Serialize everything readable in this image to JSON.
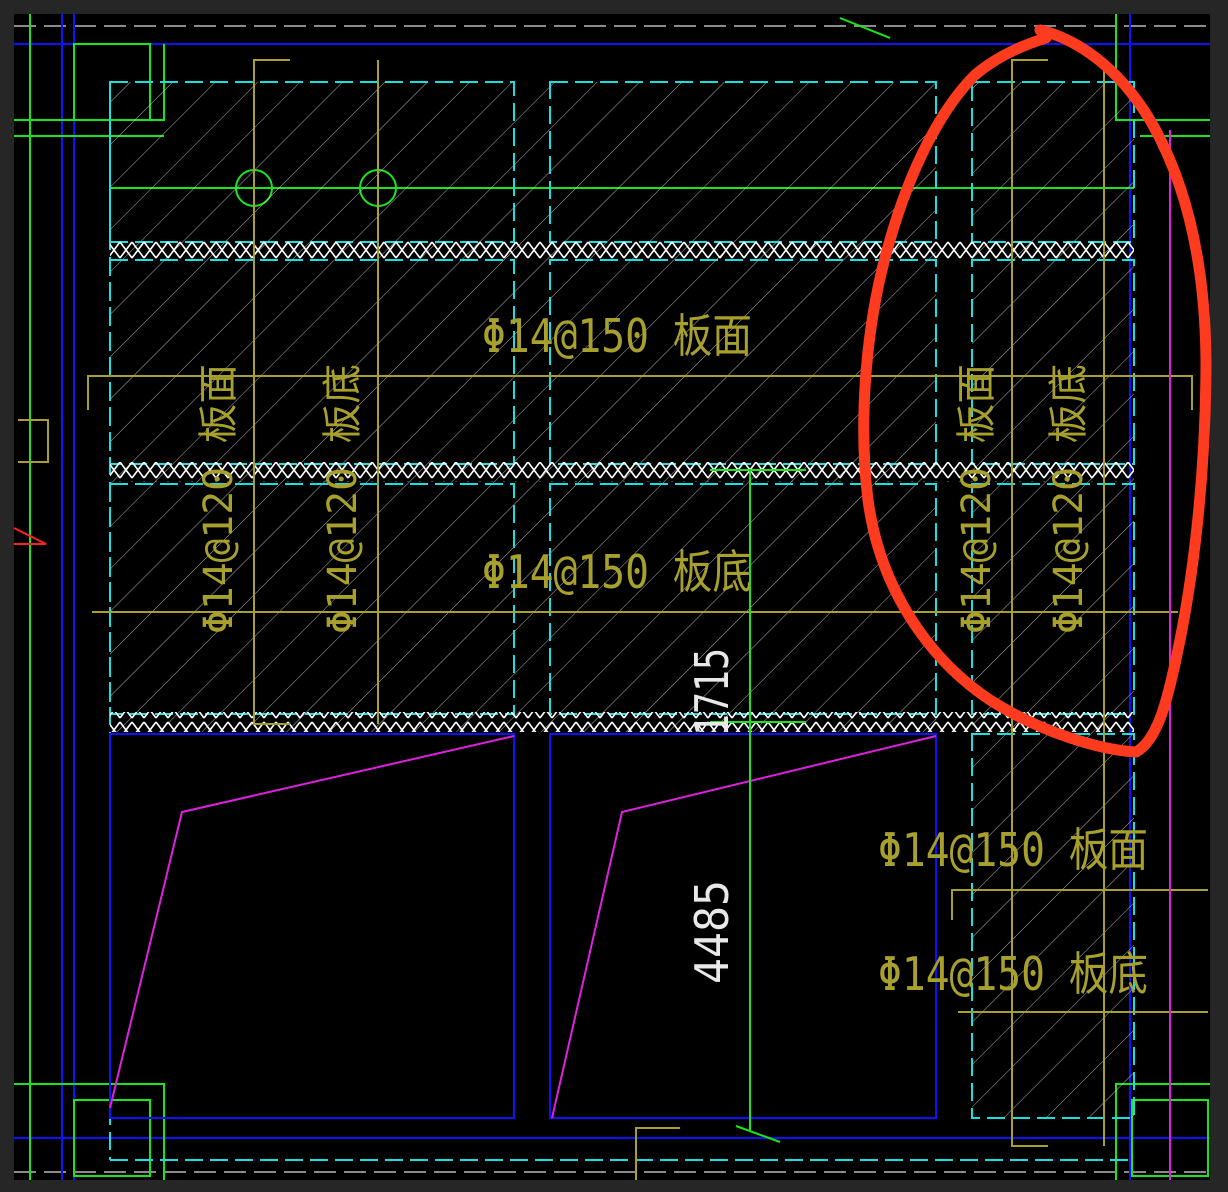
{
  "drawing": {
    "viewport_background": "#000000",
    "frame_background": "#262626",
    "colors": {
      "grid_axis": "#1010ff",
      "slab_edge": "#19e0e0",
      "column": "#19e619",
      "rebar": "#a8a02c",
      "hatch": "#cfcfcf",
      "opening": "#e020e0",
      "dimension": "#19e619",
      "annotation": "#ff3b1f",
      "centerline": "#8a8a8a"
    },
    "labels": {
      "slab_top_mid": "Φ14@150  板面",
      "slab_bottom_mid": "Φ14@150  板底",
      "left_vertical_top": "Φ14@120  板面",
      "left_vertical_bottom": "Φ14@120  板底",
      "right_vertical_top": "Φ14@120  板面",
      "right_vertical_bottom": "Φ14@120  板底",
      "right_lower_top": "Φ14@150  板面",
      "right_lower_bottom": "Φ14@150  板底"
    },
    "dimensions": {
      "dim_upper": "1715",
      "dim_lower": "4485"
    },
    "annotation_shape": "red-freehand-ellipse"
  }
}
